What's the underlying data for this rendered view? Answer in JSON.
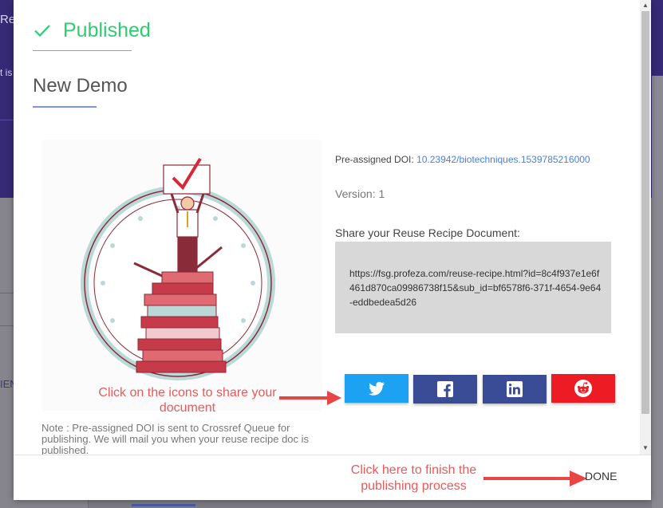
{
  "background": {
    "header_text_1": "Re",
    "header_text_2": "t is",
    "side_text": "IEN"
  },
  "modal": {
    "status": "Published",
    "title": "New Demo",
    "doi_label": "Pre-assigned DOI:",
    "doi_value": "10.23942/biotechniques.1539785216000",
    "version": "Version: 1",
    "share_label": "Share your Reuse Recipe Document:",
    "share_url": "https://fsg.profeza.com/reuse-recipe.html?id=8c4f937e1e6f461d870ca09986738f15&sub_id=bf6578f6-371f-4654-9e64-eddbedea5d26",
    "share_buttons": [
      {
        "name": "twitter",
        "icon": "twitter-icon",
        "color": "#1da1f2"
      },
      {
        "name": "facebook",
        "icon": "facebook-icon",
        "color": "#3b4c97"
      },
      {
        "name": "linkedin",
        "icon": "linkedin-icon",
        "color": "#3b4c97"
      },
      {
        "name": "reddit",
        "icon": "reddit-icon",
        "color": "#ed1c24"
      }
    ],
    "annotation_share": "Click on the icons to share your document",
    "note": "Note : Pre-assigned DOI is sent to Crossref Queue for publishing. We will mail you when your reuse recipe doc is published.",
    "annotation_done": "Click here to finish the publishing process",
    "done_label": "DONE"
  },
  "colors": {
    "success": "#2ecc71",
    "link": "#4a7fd4",
    "annotation": "#e85a5a",
    "accent_rule": "#7b93e8"
  }
}
